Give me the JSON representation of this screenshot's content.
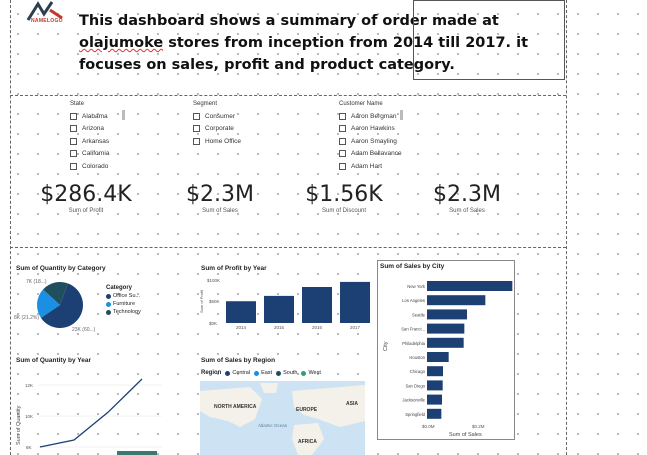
{
  "header": {
    "logo_text": "NAMELOGO",
    "intro_line1": "This dashboard shows a summary of order made at",
    "intro_line2_a": "olajumoke",
    "intro_line2_b": " stores from inception from 2014 till 2017. it",
    "intro_line3": "focuses on sales, profit and product category."
  },
  "slicers": {
    "state": {
      "title": "State",
      "items": [
        "Alabama",
        "Arizona",
        "Arkansas",
        "California",
        "Colorado"
      ]
    },
    "segment": {
      "title": "Segment",
      "items": [
        "Consumer",
        "Corporate",
        "Home Office"
      ]
    },
    "customer": {
      "title": "Customer Name",
      "items": [
        "Aaron Bergman",
        "Aaron Hawkins",
        "Aaron Smayling",
        "Adam Bellavance",
        "Adam Hart"
      ]
    }
  },
  "cards": [
    {
      "value": "$286.4K",
      "label": "Sum of Profit"
    },
    {
      "value": "$2.3M",
      "label": "Sum of Sales"
    },
    {
      "value": "$1.56K",
      "label": "Sum of Discount"
    },
    {
      "value": "$2.3M",
      "label": "Sum of Sales"
    }
  ],
  "colors": {
    "navy": "#1c3f74",
    "blue": "#1a8fe3",
    "teal": "#1f4e5f",
    "green": "#2fa36b"
  },
  "chart_data": [
    {
      "type": "pie",
      "title": "Sum of Quantity by Category",
      "legend_title": "Category",
      "legend": [
        "Office Su...",
        "Furniture",
        "Technology"
      ],
      "slice_labels": [
        "23K (60...)",
        "8K (21.2%)",
        "7K (18...)"
      ],
      "values": [
        60,
        21.2,
        18.8
      ]
    },
    {
      "type": "bar",
      "title": "Sum of Profit by Year",
      "ylabel": "Sum of Profit",
      "categories": [
        "2014",
        "2015",
        "2016",
        "2017"
      ],
      "values": [
        49.5,
        61.6,
        81.8,
        93.4
      ],
      "yticks": [
        "$0K",
        "$50K",
        "$100K"
      ],
      "ylim": [
        0,
        100
      ]
    },
    {
      "type": "bar",
      "title": "Sum of Sales by City",
      "xlabel": "Sum of Sales",
      "ylabel": "City",
      "categories": [
        "New York",
        "Los Angeles",
        "Seattle",
        "San Franci...",
        "Philadelphia",
        "Houston",
        "Chicago",
        "San Diego",
        "Jacksonville",
        "Springfield"
      ],
      "values": [
        0.256,
        0.175,
        0.12,
        0.112,
        0.11,
        0.065,
        0.048,
        0.047,
        0.045,
        0.043
      ],
      "xticks": [
        "$0.0M",
        "$0.2M"
      ],
      "xlim": [
        0,
        0.3
      ]
    },
    {
      "type": "line",
      "title": "Sum of Quantity by Year",
      "ylabel": "Sum of Quantity",
      "yticks": [
        "8K",
        "10K",
        "12K"
      ],
      "values": [
        7.6,
        8.1,
        10.1,
        12.5
      ],
      "ylim": [
        7.6,
        12.5
      ]
    },
    {
      "type": "map",
      "title": "Sum of Sales by Region",
      "legend_title": "Region",
      "legend": [
        "Central",
        "East",
        "South",
        "West"
      ],
      "places": [
        "NORTH AMERICA",
        "EUROPE",
        "ASIA",
        "Atlantic Ocean",
        "AFRICA"
      ]
    }
  ]
}
